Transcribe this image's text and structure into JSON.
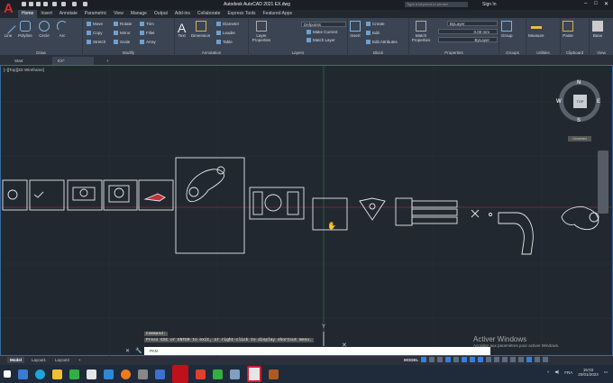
{
  "app": {
    "title": "Autodesk AutoCAD 2021   EX.dwg",
    "search_placeholder": "Type a keyword or phrase",
    "sign_in": "Sign In"
  },
  "menu_tabs": [
    "Home",
    "Insert",
    "Annotate",
    "Parametric",
    "View",
    "Manage",
    "Output",
    "Add-ins",
    "Collaborate",
    "Express Tools",
    "Featured Apps"
  ],
  "ribbon": {
    "draw": {
      "title": "Draw",
      "tools": [
        "Line",
        "Polyline",
        "Circle",
        "Arc"
      ]
    },
    "modify": {
      "title": "Modify",
      "tools": [
        "Move",
        "Rotate",
        "Trim",
        "Copy",
        "Mirror",
        "Fillet",
        "Stretch",
        "Scale",
        "Array"
      ]
    },
    "annotation": {
      "title": "Annotation",
      "tools": [
        "Text",
        "Dimension",
        "Diameter",
        "Leader",
        "Table"
      ]
    },
    "layers": {
      "title": "Layers",
      "tools": [
        "Layer Properties",
        "Make Current",
        "Match Layer"
      ],
      "layer_value": "Defpoints"
    },
    "block": {
      "title": "Block",
      "tools": [
        "Insert",
        "Create",
        "Edit",
        "Edit Attributes"
      ]
    },
    "properties": {
      "title": "Properties",
      "match": "Match Properties",
      "color": "ByLayer",
      "lineweight": "0.00 mm",
      "linetype": "ByLayer"
    },
    "groups": {
      "title": "Groups",
      "tool": "Group"
    },
    "utilities": {
      "title": "Utilities",
      "tool": "Measure"
    },
    "clipboard": {
      "title": "Clipboard",
      "tool": "Paste"
    },
    "view": {
      "title": "View",
      "tool": "Base"
    }
  },
  "file_tabs": [
    "Start",
    "EX*"
  ],
  "viewport": {
    "label": "[–][Top][2D Wireframe]",
    "compass": {
      "n": "N",
      "s": "S",
      "e": "E",
      "w": "W",
      "top": "TOP"
    },
    "wcs": "Unnamed",
    "y_axis": "Y"
  },
  "command": {
    "lines": [
      "Command:",
      "Press ESC or ENTER to exit, or right-click to display shortcut menu."
    ],
    "input": "PAN"
  },
  "watermark": {
    "title": "Activer Windows",
    "subtitle": "Accédez aux paramètres pour activer Windows."
  },
  "layout_tabs": [
    "Model",
    "Layout1",
    "Layout2",
    "+"
  ],
  "status": {
    "mode": "MODEL"
  },
  "tray": {
    "lang": "FRA",
    "time": "15:03",
    "date": "20/01/2023"
  }
}
